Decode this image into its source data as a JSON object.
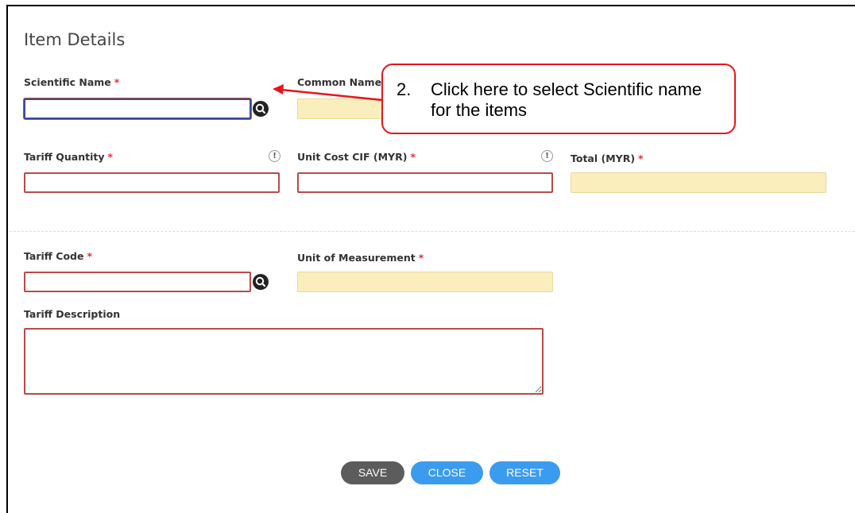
{
  "form": {
    "title": "Item Details",
    "required_marker": "*",
    "fields": {
      "scientific_name": {
        "label": "Scientific Name",
        "value": ""
      },
      "common_name": {
        "label": "Common Name",
        "value": ""
      },
      "tariff_quantity": {
        "label": "Tariff Quantity",
        "value": ""
      },
      "unit_cost": {
        "label": "Unit Cost CIF (MYR)",
        "value": ""
      },
      "total": {
        "label": "Total (MYR)",
        "value": ""
      },
      "tariff_code": {
        "label": "Tariff Code",
        "value": ""
      },
      "unit_of_measurement": {
        "label": "Unit of Measurement",
        "value": ""
      },
      "tariff_description": {
        "label": "Tariff Description",
        "value": ""
      }
    },
    "info_glyph": "!",
    "buttons": {
      "save": "SAVE",
      "close": "CLOSE",
      "reset": "RESET"
    }
  },
  "callout": {
    "number": "2.",
    "text": "Click here to select Scientific name for the items",
    "border_color": "#e8141c"
  },
  "colors": {
    "required_input_border": "#b84a4a",
    "readonly_bg": "#fbeebd",
    "save_button": "#5c5c5c",
    "primary_button": "#3b9bef"
  },
  "icons": [
    "search-icon",
    "info-icon",
    "callout-arrow"
  ]
}
